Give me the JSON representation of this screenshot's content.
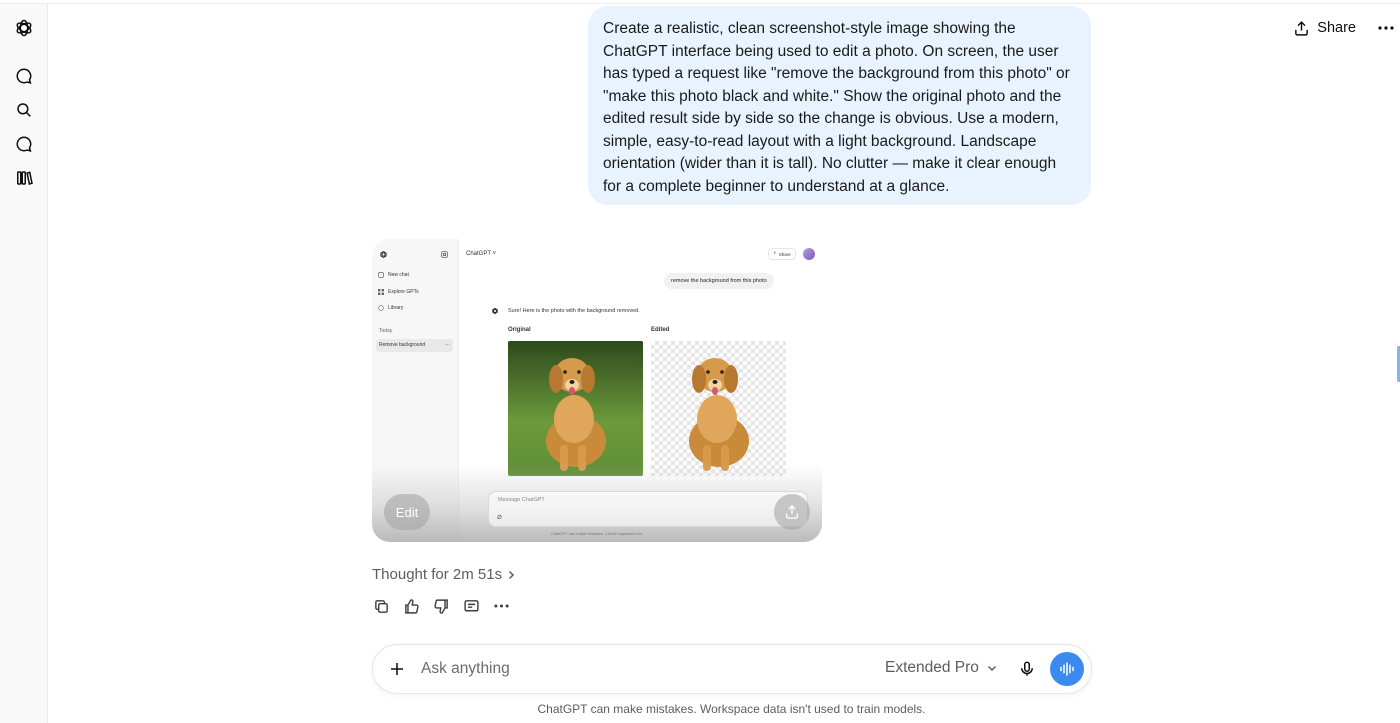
{
  "app": {
    "colors": {
      "accent": "#3b8af0",
      "user_bubble": "#e8f3ff",
      "text": "#0d0d0d",
      "muted": "#5d5d5d"
    }
  },
  "sidebar": {
    "icons": [
      "openai-logo-icon",
      "new-chat-icon",
      "search-icon",
      "chat-bubble-icon",
      "library-icon"
    ]
  },
  "header": {
    "share_label": "Share",
    "more_icon": "more-horizontal-icon"
  },
  "conversation": {
    "user_message": "Create a realistic, clean screenshot-style image showing the ChatGPT interface being used to edit a photo. On screen, the user has typed a request like \"remove the background from this photo\" or \"make this photo black and white.\" Show the original photo and the edited result side by side so the change is obvious. Use a modern, simple, easy-to-read layout with a light background. Landscape orientation (wider than it is tall). No clutter — make it clear enough for a complete beginner to understand at a glance.",
    "generated_image": {
      "title": "ChatGPT",
      "share": "Share",
      "sidebar_items": [
        "New chat",
        "Explore GPTs",
        "Library"
      ],
      "section_today": "Today",
      "selected_chat": "Remove background",
      "request": "remove the background from this photo",
      "reply": "Sure! Here is the photo with the background removed.",
      "original_label": "Original",
      "edited_label": "Edited",
      "input_placeholder": "Message ChatGPT",
      "footer": "ChatGPT can make mistakes. Check important info.",
      "edit_button": "Edit"
    },
    "thought_label": "Thought for 2m 51s",
    "action_icons": [
      "copy-icon",
      "thumbs-up-icon",
      "thumbs-down-icon",
      "comment-icon",
      "more-icon"
    ]
  },
  "composer": {
    "placeholder": "Ask anything",
    "model_label": "Extended Pro"
  },
  "footer": {
    "disclaimer": "ChatGPT can make mistakes. Workspace data isn't used to train models."
  }
}
